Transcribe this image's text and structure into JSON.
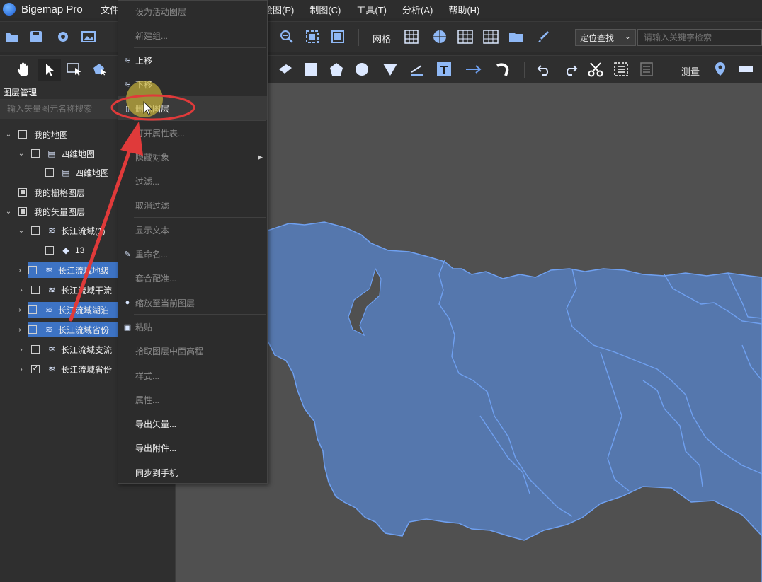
{
  "app": {
    "title": "Bigemap Pro"
  },
  "menu": {
    "file": "文件",
    "draw": "绘图(P)",
    "cartography": "制图(C)",
    "tools": "工具(T)",
    "analysis": "分析(A)",
    "help": "帮助(H)"
  },
  "toolbar": {
    "grid_label": "网格",
    "locate_select": "定位查找",
    "search_placeholder": "请输入关键字检索",
    "measure_label": "测量"
  },
  "layer_panel": {
    "title": "图层管理",
    "search_placeholder": "输入矢量图元名称搜索",
    "nodes": [
      {
        "label": "我的地图",
        "checkbox": "unchecked",
        "expander": "expanded"
      },
      {
        "label": "四维地图",
        "checkbox": "unchecked",
        "expander": "expanded",
        "icon": "map-icon"
      },
      {
        "label": "四维地图",
        "checkbox": "unchecked",
        "icon": "map-icon"
      },
      {
        "label": "我的栅格图层",
        "checkbox": "partial"
      },
      {
        "label": "我的矢量图层",
        "checkbox": "partial",
        "expander": "expanded"
      },
      {
        "label": "长江流域(1)",
        "checkbox": "unchecked",
        "expander": "expanded",
        "icon": "layers-icon"
      },
      {
        "label": "13",
        "checkbox": "unchecked",
        "icon": "polygon-icon"
      },
      {
        "label": "长江流域地级",
        "checkbox": "unchecked",
        "expander": "collapsed",
        "icon": "layers-icon",
        "selected": true
      },
      {
        "label": "长江流域干流",
        "checkbox": "unchecked",
        "expander": "collapsed",
        "icon": "layers-icon",
        "selected": false
      },
      {
        "label": "长江流域湖泊",
        "checkbox": "unchecked",
        "expander": "collapsed",
        "icon": "layers-icon",
        "selected": true
      },
      {
        "label": "长江流域省份",
        "checkbox": "unchecked",
        "expander": "collapsed",
        "icon": "layers-icon",
        "selected": true
      },
      {
        "label": "长江流域支流",
        "checkbox": "unchecked",
        "expander": "collapsed",
        "icon": "layers-icon",
        "selected": false
      },
      {
        "label": "长江流域省份",
        "checkbox": "checked",
        "expander": "collapsed",
        "icon": "layers-icon",
        "selected": false
      }
    ]
  },
  "context_menu": {
    "items": [
      {
        "label": "设为活动图层",
        "enabled": false
      },
      {
        "label": "新建组...",
        "enabled": false
      },
      {
        "label": "上移",
        "enabled": true,
        "icon": "layer-up-icon"
      },
      {
        "label": "下移",
        "enabled": true,
        "icon": "layer-down-icon"
      },
      {
        "label": "删除图层",
        "enabled": true,
        "icon": "delete-layer-icon",
        "highlighted": true
      },
      {
        "label": "打开属性表...",
        "enabled": false
      },
      {
        "label": "隐藏对象",
        "enabled": false,
        "submenu": true
      },
      {
        "label": "过滤...",
        "enabled": false
      },
      {
        "label": "取消过滤",
        "enabled": false
      },
      {
        "label": "显示文本",
        "enabled": false
      },
      {
        "label": "重命名...",
        "enabled": false,
        "icon": "rename-icon"
      },
      {
        "label": "套合配准...",
        "enabled": false
      },
      {
        "label": "缩放至当前图层",
        "enabled": false,
        "icon": "zoom-to-layer-icon"
      },
      {
        "label": "粘贴",
        "enabled": false,
        "icon": "paste-icon"
      },
      {
        "label": "拾取图层中面高程",
        "enabled": false
      },
      {
        "label": "样式...",
        "enabled": false
      },
      {
        "label": "属性...",
        "enabled": false
      },
      {
        "label": "导出矢量...",
        "enabled": true
      },
      {
        "label": "导出附件...",
        "enabled": true
      },
      {
        "label": "同步到手机",
        "enabled": true
      }
    ]
  },
  "colors": {
    "map_background": "#505050",
    "region_fill": "#5577ad",
    "region_border": "#6fa0f0",
    "selection": "#3d73c4",
    "annotation": "#e03a3a"
  }
}
